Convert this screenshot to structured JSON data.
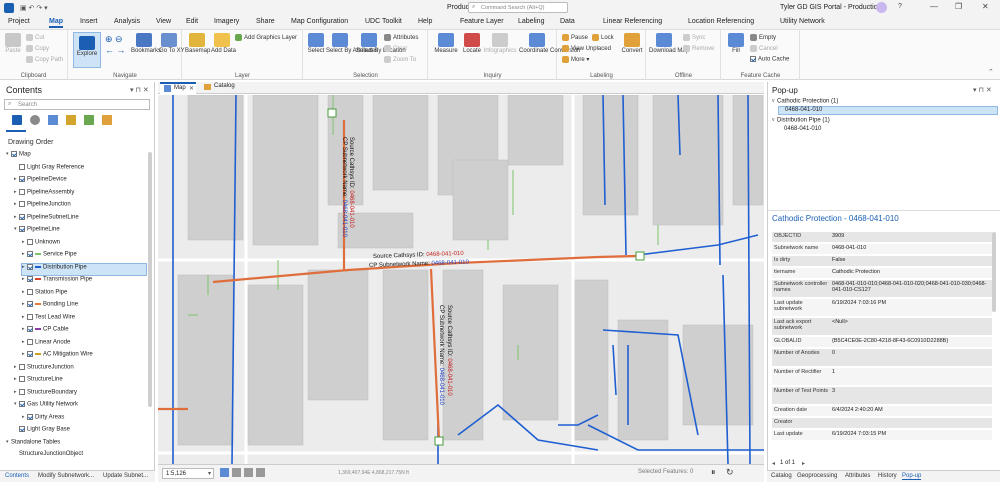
{
  "titlebar": {
    "quick": "Production",
    "search_placeholder": "Command Search (Alt+Q)",
    "user": "Tyler",
    "portal": "GD GIS Portal - Production"
  },
  "tabs": [
    "Project",
    "Map",
    "Insert",
    "Analysis",
    "View",
    "Edit",
    "Imagery",
    "Share",
    "Map Configuration",
    "UDC Toolkit",
    "Help",
    "Feature Layer",
    "Labeling",
    "Data",
    "Linear Referencing",
    "Location Referencing",
    "Utility Network"
  ],
  "ribbon": {
    "clipboard": {
      "label": "Clipboard",
      "paste": "Paste",
      "cut": "Cut",
      "copy": "Copy",
      "copy_path": "Copy Path"
    },
    "navigate": {
      "label": "Navigate",
      "explore": "Explore",
      "bookmarks": "Bookmarks",
      "goto": "Go To XY"
    },
    "layer": {
      "label": "Layer",
      "basemap": "Basemap",
      "add_data": "Add Data",
      "add_graphics": "Add Graphics Layer"
    },
    "selection": {
      "label": "Selection",
      "select": "Select",
      "by_attr": "Select By Attributes",
      "by_loc": "Select By Location",
      "attributes": "Attributes",
      "clear": "Clear",
      "zoom_to": "Zoom To"
    },
    "inquiry": {
      "label": "Inquiry",
      "measure": "Measure",
      "locate": "Locate",
      "infographics": "Infographics",
      "coord": "Coordinate Conversion"
    },
    "labeling": {
      "label": "Labeling",
      "pause": "Pause",
      "lock": "Lock",
      "view_unplaced": "View Unplaced",
      "more": "More",
      "convert": "Convert"
    },
    "offline": {
      "label": "Offline",
      "download": "Download Map",
      "sync": "Sync",
      "remove": "Remove"
    },
    "cache": {
      "label": "Feature Cache",
      "fill": "Fill",
      "empty": "Empty",
      "cancel": "Cancel",
      "auto": "Auto Cache"
    }
  },
  "contents": {
    "title": "Contents",
    "search_placeholder": "Search",
    "drawing_order": "Drawing Order",
    "rows": [
      {
        "t": "Map",
        "l": 0,
        "c": true,
        "e": "v",
        "sw": ""
      },
      {
        "t": "Light Gray Reference",
        "l": 1,
        "c": false,
        "e": "",
        "sw": ""
      },
      {
        "t": "PipelineDevice",
        "l": 1,
        "c": true,
        "e": ">",
        "sw": ""
      },
      {
        "t": "PipelineAssembly",
        "l": 1,
        "c": false,
        "e": ">",
        "sw": ""
      },
      {
        "t": "PipelineJunction",
        "l": 1,
        "c": false,
        "e": ">",
        "sw": ""
      },
      {
        "t": "PipelineSubnetLine",
        "l": 1,
        "c": true,
        "e": ">",
        "sw": ""
      },
      {
        "t": "PipelineLine",
        "l": 1,
        "c": true,
        "e": "v",
        "sw": ""
      },
      {
        "t": "Unknown",
        "l": 2,
        "c": false,
        "e": ">",
        "sw": ""
      },
      {
        "t": "Service Pipe",
        "l": 2,
        "c": true,
        "e": ">",
        "sw": "#7cc46c"
      },
      {
        "t": "Distribution Pipe",
        "l": 2,
        "c": true,
        "e": ">",
        "sw": "#1f5fd1"
      },
      {
        "t": "Transmission Pipe",
        "l": 2,
        "c": true,
        "e": ">",
        "sw": "#d2452c"
      },
      {
        "t": "Station Pipe",
        "l": 2,
        "c": false,
        "e": ">",
        "sw": ""
      },
      {
        "t": "Bonding Line",
        "l": 2,
        "c": true,
        "e": ">",
        "sw": "#e07b39"
      },
      {
        "t": "Test Lead Wire",
        "l": 2,
        "c": false,
        "e": ">",
        "sw": ""
      },
      {
        "t": "CP Cable",
        "l": 2,
        "c": true,
        "e": ">",
        "sw": "#8a3fa8"
      },
      {
        "t": "Linear Anode",
        "l": 2,
        "c": false,
        "e": ">",
        "sw": ""
      },
      {
        "t": "AC Mitigation Wire",
        "l": 2,
        "c": true,
        "e": ">",
        "sw": "#c9a227"
      },
      {
        "t": "StructureJunction",
        "l": 1,
        "c": false,
        "e": ">",
        "sw": ""
      },
      {
        "t": "StructureLine",
        "l": 1,
        "c": false,
        "e": ">",
        "sw": ""
      },
      {
        "t": "StructureBoundary",
        "l": 1,
        "c": false,
        "e": ">",
        "sw": ""
      },
      {
        "t": "Gas Utility Network",
        "l": 1,
        "c": true,
        "e": "v",
        "sw": ""
      },
      {
        "t": "Dirty Areas",
        "l": 2,
        "c": true,
        "e": ">",
        "sw": ""
      },
      {
        "t": "Light Gray Base",
        "l": 1,
        "c": true,
        "e": "",
        "sw": ""
      },
      {
        "t": "Standalone Tables",
        "l": 0,
        "c": null,
        "e": "v",
        "sw": ""
      },
      {
        "t": "StructureJunctionObject",
        "l": 1,
        "c": null,
        "e": "",
        "sw": ""
      }
    ],
    "selected": "Distribution Pipe",
    "bottom_tabs": [
      "Contents",
      "Modify Subnetwork...",
      "Update Subnet..."
    ]
  },
  "map": {
    "tab": "Map",
    "tab2": "Catalog",
    "label1_a": "Source Cathsys ID: ",
    "label1_b": "0468-041-010",
    "label1_c": "CP Subnetwork Name: ",
    "label1_d": "0468-041-010",
    "label2_a": "Source Cathsys ID: ",
    "label2_b": "0468-041-010",
    "label2_c": "CP Subnetwork Name: ",
    "label2_d": "0468-041-010",
    "label3_a": "Source Cathsys ID: ",
    "label3_b": "0468-041-010",
    "label3_c": "CP Subnetwork Name: ",
    "label3_d": "0468-041-010",
    "scale": "1:5,126",
    "coords": "1,369,407.94E 4,868,217.75N ft",
    "selected_features": "Selected Features: 0"
  },
  "popup": {
    "title": "Pop-up",
    "g1": "Cathodic Protection (1)",
    "g1_item": "0468-041-010",
    "g2": "Distribution Pipe (1)",
    "g2_item": "0468-041-010",
    "detail_title": "Cathodic Protection - 0468-041-010",
    "attrs": [
      {
        "k": "OBJECTID",
        "v": "3909",
        "h": 11
      },
      {
        "k": "Subnetwork name",
        "v": "0468-041-010",
        "h": 11
      },
      {
        "k": "Is dirty",
        "v": "False",
        "h": 11
      },
      {
        "k": "tiername",
        "v": "Cathodic Protection",
        "h": 11
      },
      {
        "k": "Subnetwork controller names",
        "v": "0468-041-010-010;0468-041-010-020;0468-041-010-030;0468-041-010-CS127",
        "h": 18
      },
      {
        "k": "Last update subnetwork",
        "v": "6/19/2024 7:03:16 PM",
        "h": 18
      },
      {
        "k": "Last ack export subnetwork",
        "v": "<Null>",
        "h": 18
      },
      {
        "k": "GLOBALID",
        "v": "{B5C4CE0E-2C80-4218-8F43-6C0910D2288B}",
        "h": 11
      },
      {
        "k": "Number of Anodes",
        "v": "0",
        "h": 18
      },
      {
        "k": "Number of Rectifier",
        "v": "1",
        "h": 18
      },
      {
        "k": "Number of Test Points",
        "v": "3",
        "h": 18
      },
      {
        "k": "Creation date",
        "v": "6/4/2024 2:40:20 AM",
        "h": 11
      },
      {
        "k": "Creator",
        "v": "",
        "h": 11
      },
      {
        "k": "Last update",
        "v": "6/19/2024 7:03:15 PM",
        "h": 11
      }
    ],
    "nav": "1 of 1",
    "tabs": [
      "Catalog",
      "Geoprocessing",
      "Attributes",
      "History",
      "Pop-up"
    ]
  }
}
